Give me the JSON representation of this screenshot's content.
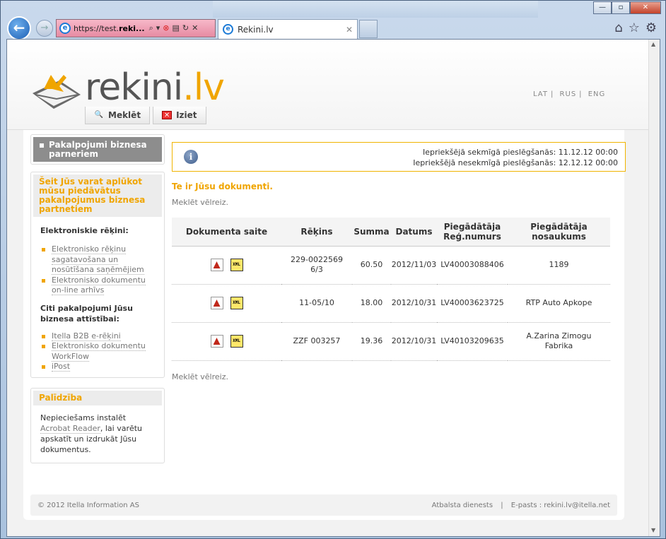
{
  "browser": {
    "url_prefix": "https://test.",
    "url_bold": "reki...",
    "tab_title": "Rekini.lv"
  },
  "header": {
    "logo_main": "rekini",
    "logo_suffix": ".lv",
    "langs": [
      "LAT",
      "RUS",
      "ENG"
    ],
    "nav": {
      "search": "Meklēt",
      "exit": "Iziet"
    }
  },
  "sidebar": {
    "services_title": "Pakalpojumi biznesa parneriem",
    "offers_title": "Šeit Jūs varat aplūkot mūsu piedāvātus pakalpojumus biznesa partnetiem",
    "einvoices_label": "Elektroniskie rēķini:",
    "einvoices_items": [
      "Elektronisko rēķinu sagatavošana un nosūtīšana saņēmējiem",
      "Elektronisko dokumentu on-line arhīvs"
    ],
    "other_label": "Citi pakalpojumi Jūsu biznesa attīstībai:",
    "other_items": [
      "Itella B2B e-rēķini",
      "Elektronisko dokumentu WorkFlow",
      "iPost"
    ],
    "help_title": "Palīdzība",
    "help_text_1": "Nepieciešams instalēt",
    "help_link": "Acrobat Reader",
    "help_text_2": ", lai varētu apskatīt un izdrukāt Jūsu dokumentus."
  },
  "main": {
    "login_ok": "Iepriekšējā sekmīgā pieslēgšanās: 11.12.12 00:00",
    "login_fail": "Iepriekšējā nesekmīgā pieslēgšanās: 12.12.12 00:00",
    "heading": "Te ir Jūsu dokumenti.",
    "search_again": "Meklēt vēlreiz.",
    "columns": [
      "Dokumenta saite",
      "Rēķins",
      "Summa",
      "Datums",
      "Piegādātāja Reģ.numurs",
      "Piegādātāja nosaukums"
    ],
    "rows": [
      {
        "invoice": "229-00225696/3",
        "sum": "60.50",
        "date": "2012/11/03",
        "reg": "LV40003088406",
        "name": "1189"
      },
      {
        "invoice": "11-05/10",
        "sum": "18.00",
        "date": "2012/10/31",
        "reg": "LV40003623725",
        "name": "RTP Auto Apkope"
      },
      {
        "invoice": "ZZF 003257",
        "sum": "19.36",
        "date": "2012/10/31",
        "reg": "LV40103209635",
        "name": "A.Zarina Zimogu Fabrika"
      }
    ],
    "pdf_icon": "pdf-icon",
    "xml_icon": "xml-icon",
    "xml_label": "XML"
  },
  "footer": {
    "copyright": "© 2012 Itella Information AS",
    "support": "Atbalsta dienests",
    "email": "E-pasts : rekini.lv@itella.net"
  }
}
